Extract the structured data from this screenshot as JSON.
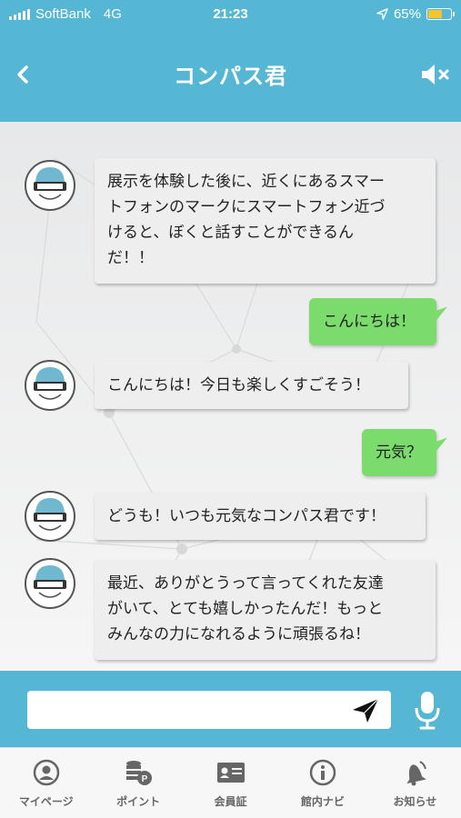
{
  "status_bar": {
    "carrier": "SoftBank",
    "network": "4G",
    "time": "21:23",
    "battery": "65%",
    "battery_level": 0.65
  },
  "header": {
    "title": "コンパス君",
    "back_icon": "chevron-left-icon",
    "mute_icon": "speaker-mute-icon"
  },
  "messages": [
    {
      "from": "bot",
      "lines": [
        "展示を体験した後に、近くにあるスマー",
        "トフォンのマークにスマートフォン近づ",
        "けると、ぼくと話すことができるん",
        "だ！！"
      ]
    },
    {
      "from": "user",
      "text": "こんにちは！"
    },
    {
      "from": "bot",
      "lines": [
        "こんにちは！今日も楽しくすごそう！"
      ]
    },
    {
      "from": "user",
      "text": "元気？"
    },
    {
      "from": "bot",
      "lines": [
        "どうも！いつも元気なコンパス君です！"
      ]
    },
    {
      "from": "bot",
      "lines": [
        "最近、ありがとうって言ってくれた友達",
        "がいて、とても嬉しかったんだ！もっと",
        "みんなの力になれるように頑張るね！"
      ]
    }
  ],
  "input": {
    "value": "",
    "placeholder": ""
  },
  "tabs": [
    {
      "label": "マイページ",
      "icon": "person-icon"
    },
    {
      "label": "ポイント",
      "icon": "coins-icon"
    },
    {
      "label": "会員証",
      "icon": "id-card-icon"
    },
    {
      "label": "館内ナビ",
      "icon": "info-icon"
    },
    {
      "label": "お知らせ",
      "icon": "bell-icon"
    }
  ],
  "colors": {
    "accent": "#55b7d4",
    "user_bubble": "#7bdb6c",
    "bot_bubble": "#eeeeee"
  }
}
